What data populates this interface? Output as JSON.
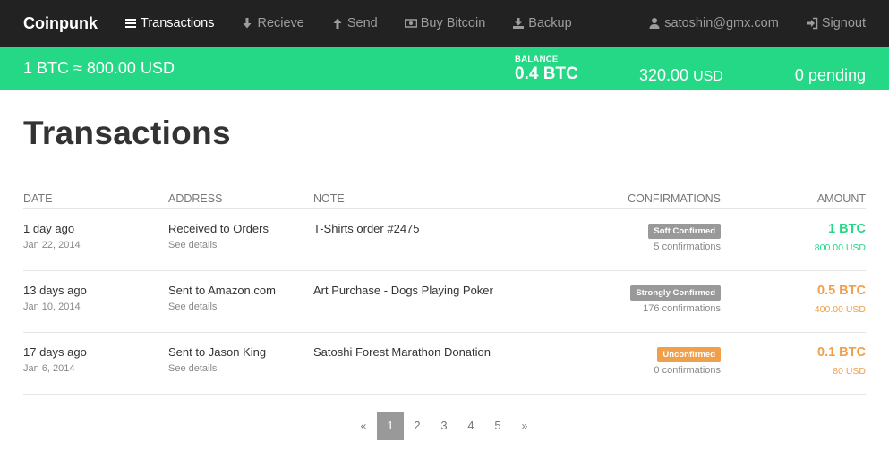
{
  "navbar": {
    "brand": "Coinpunk",
    "items": [
      {
        "label": "Transactions",
        "icon": "menu-icon"
      },
      {
        "label": "Recieve",
        "icon": "arrow-down-icon"
      },
      {
        "label": "Send",
        "icon": "arrow-up-icon"
      },
      {
        "label": "Buy Bitcoin",
        "icon": "money-icon"
      },
      {
        "label": "Backup",
        "icon": "download-icon"
      }
    ],
    "user_email": "satoshin@gmx.com",
    "signout_label": "Signout"
  },
  "balance": {
    "exchange_rate": "1 BTC ≈ 800.00 USD",
    "label": "BALANCE",
    "btc": "0.4 BTC",
    "usd_value": "320.00",
    "usd_unit": "USD",
    "pending": "0 pending"
  },
  "page_title": "Transactions",
  "table": {
    "headers": [
      "DATE",
      "ADDRESS",
      "NOTE",
      "CONFIRMATIONS",
      "AMOUNT"
    ],
    "rows": [
      {
        "date_relative": "1 day ago",
        "date": "Jan 22, 2014",
        "address": "Received to Orders",
        "details_link": "See details",
        "note": "T-Shirts order #2475",
        "status": "Soft Confirmed",
        "confirmations": "5 confirmations",
        "amount_btc": "1 BTC",
        "amount_usd": "800.00 USD"
      },
      {
        "date_relative": "13 days ago",
        "date": "Jan 10, 2014",
        "address": "Sent to Amazon.com",
        "details_link": "See details",
        "note": "Art Purchase - Dogs Playing Poker",
        "status": "Strongly Confirmed",
        "confirmations": "176 confirmations",
        "amount_btc": "0.5 BTC",
        "amount_usd": "400.00 USD"
      },
      {
        "date_relative": "17 days ago",
        "date": "Jan 6, 2014",
        "address": "Sent to Jason King",
        "details_link": "See details",
        "note": "Satoshi Forest Marathon Donation",
        "status": "Unconfirmed",
        "confirmations": "0 confirmations",
        "amount_btc": "0.1 BTC",
        "amount_usd": "80 USD"
      }
    ]
  },
  "pagination": {
    "prev": "«",
    "pages": [
      "1",
      "2",
      "3",
      "4",
      "5"
    ],
    "next": "»",
    "current": "1"
  },
  "colors": {
    "navbar_bg": "#222222",
    "accent_green": "#24d886",
    "accent_orange": "#f0a04b",
    "badge_gray": "#999999"
  }
}
